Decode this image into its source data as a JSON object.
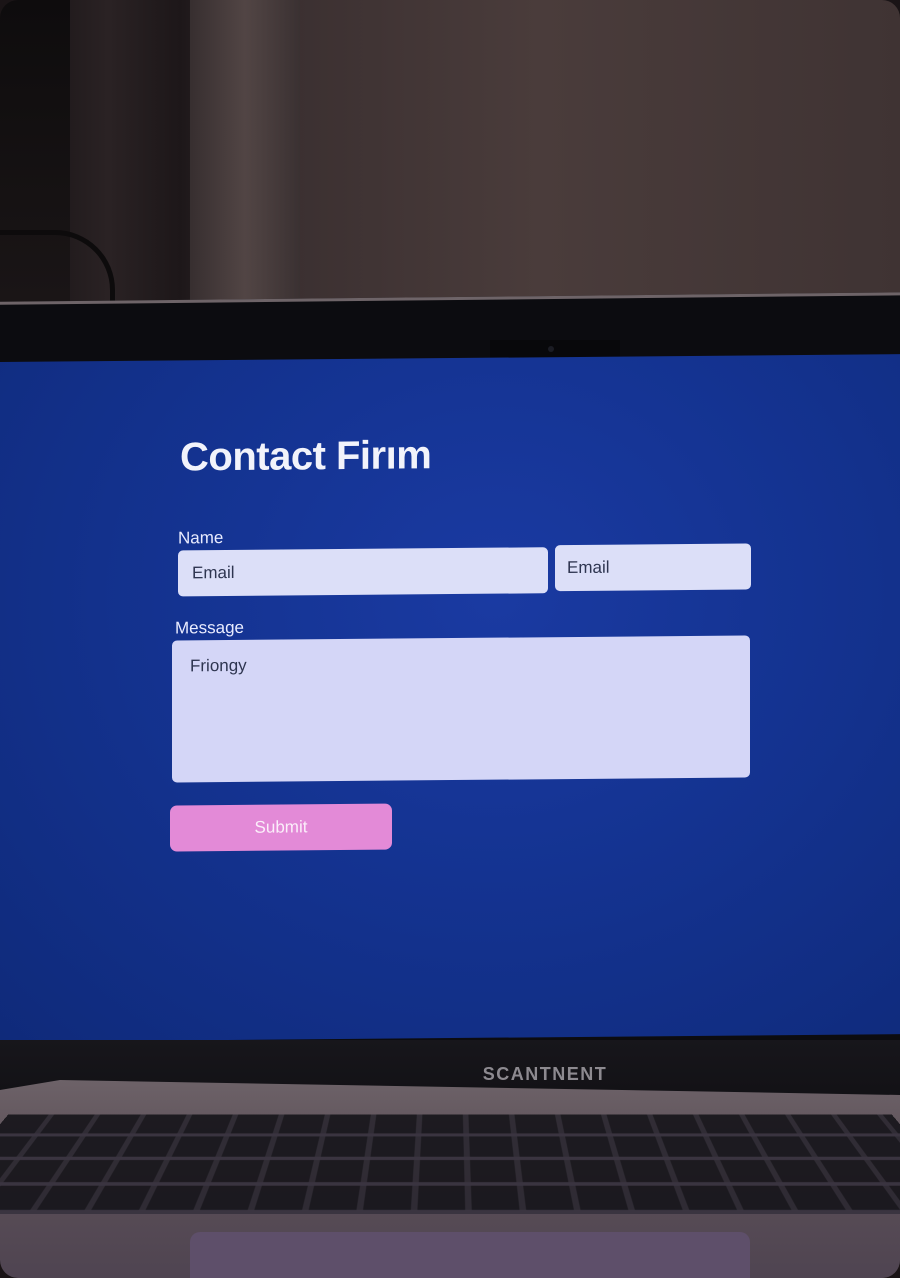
{
  "form": {
    "title": "Contact Firım",
    "name_label": "Name",
    "name_placeholder": "Email",
    "email_placeholder": "Email",
    "message_label": "Message",
    "message_value": "Friongy",
    "submit_label": "Submit"
  },
  "laptop": {
    "brand_text": "SCANTNENT"
  },
  "colors": {
    "screen_background": "#143391",
    "field_background": "#dcdff8",
    "submit_background": "#e38ad7"
  }
}
